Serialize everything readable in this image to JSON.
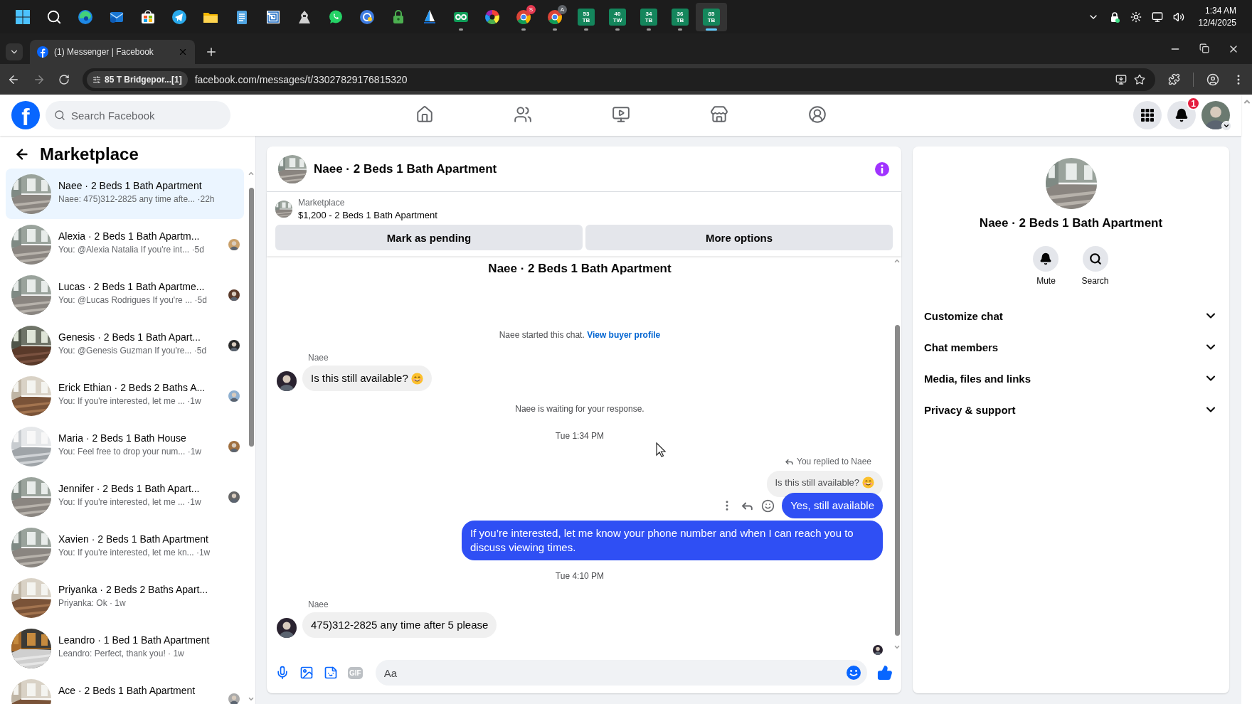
{
  "taskbar": {
    "apps": [
      {
        "kind": "start",
        "running": false,
        "selected": false
      },
      {
        "kind": "search",
        "running": false,
        "selected": false
      },
      {
        "kind": "edge",
        "running": false,
        "selected": false
      },
      {
        "kind": "mail",
        "running": false,
        "selected": false
      },
      {
        "kind": "store",
        "running": false,
        "selected": false
      },
      {
        "kind": "telegram",
        "running": false,
        "selected": false
      },
      {
        "kind": "folder",
        "running": false,
        "selected": false
      },
      {
        "kind": "notepad",
        "running": false,
        "selected": false
      },
      {
        "kind": "maze",
        "running": false,
        "selected": false
      },
      {
        "kind": "figure",
        "running": false,
        "selected": false
      },
      {
        "kind": "whatsapp",
        "running": false,
        "selected": false
      },
      {
        "kind": "orb",
        "running": false,
        "selected": false
      },
      {
        "kind": "lock",
        "running": false,
        "selected": false
      },
      {
        "kind": "sail",
        "running": false,
        "selected": false
      },
      {
        "kind": "tape",
        "running": true,
        "selected": false
      },
      {
        "kind": "wheel",
        "running": false,
        "selected": false
      },
      {
        "kind": "chrome",
        "badge": "S",
        "running": true,
        "selected": false
      },
      {
        "kind": "chrome",
        "badge": "A",
        "running": true,
        "selected": false
      },
      {
        "kind": "tile",
        "label": "53 TB",
        "running": true,
        "selected": false
      },
      {
        "kind": "tile",
        "label": "40 TW",
        "running": true,
        "selected": false
      },
      {
        "kind": "tile",
        "label": "34 TB",
        "running": true,
        "selected": false
      },
      {
        "kind": "tile",
        "label": "36 TB",
        "running": true,
        "selected": false
      },
      {
        "kind": "tile",
        "label": "85 TB",
        "running": true,
        "selected": true
      }
    ],
    "time": "1:34 AM",
    "date": "12/4/2025"
  },
  "browser": {
    "tab": {
      "title": "(1) Messenger | Facebook"
    },
    "site_chip": "85 T Bridgepor...[1]",
    "url": "facebook.com/messages/t/33027829176815320"
  },
  "facebook": {
    "logo": "f",
    "search": {
      "placeholder": "Search Facebook"
    },
    "nav": [
      {
        "kind": "home",
        "selected": false
      },
      {
        "kind": "friends",
        "selected": false
      },
      {
        "kind": "video",
        "selected": false
      },
      {
        "kind": "marketplace",
        "selected": false
      },
      {
        "kind": "groups",
        "selected": false
      }
    ],
    "notifications_badge": "1"
  },
  "sidebar": {
    "title": "Marketplace",
    "conversations": [
      {
        "title": "Naee · 2 Beds 1 Bath Apartment",
        "preview": "Naee: 475)312-2825 any time afte... ·22h",
        "selected": true,
        "seen": false
      },
      {
        "title": "Alexia · 2 Beds 1 Bath Apartm...",
        "preview": "You: @Alexia Natalia If you're int... ·5d",
        "selected": false,
        "seen": true
      },
      {
        "title": "Lucas · 2 Beds 1 Bath Apartme...",
        "preview": "You: @Lucas Rodrigues If you're ... ·5d",
        "selected": false,
        "seen": true
      },
      {
        "title": "Genesis · 2 Beds 1 Bath Apart...",
        "preview": "You: @Genesis Guzman If you're... ·5d",
        "selected": false,
        "seen": true
      },
      {
        "title": "Erick Ethian · 2 Beds 2 Baths A...",
        "preview": "You: If you're interested, let me ... ·1w",
        "selected": false,
        "seen": true
      },
      {
        "title": "Maria · 2 Beds 1 Bath House",
        "preview": "You: Feel free to drop your num... ·1w",
        "selected": false,
        "seen": true
      },
      {
        "title": "Jennifer · 2 Beds 1 Bath Apart...",
        "preview": "You: If you're interested, let me ... ·1w",
        "selected": false,
        "seen": true
      },
      {
        "title": "Xavien · 2 Beds 1 Bath Apartment",
        "preview": "You: If you're interested, let me kn... ·1w",
        "selected": false,
        "seen": false
      },
      {
        "title": "Priyanka · 2 Beds 2 Baths Apart...",
        "preview": "Priyanka: Ok · 1w",
        "selected": false,
        "seen": false
      },
      {
        "title": "Leandro · 1 Bed 1 Bath Apartment",
        "preview": "Leandro: Perfect, thank you! · 1w",
        "selected": false,
        "seen": false
      },
      {
        "title": "Ace · 2 Beds 1 Bath Apartment",
        "selected": false,
        "seen": true
      }
    ]
  },
  "chat": {
    "title": "Naee · 2 Beds 1 Bath Apartment",
    "listing": {
      "label": "Marketplace",
      "title": "$1,200 - 2 Beds 1 Bath Apartment"
    },
    "buttons": [
      "Mark as pending",
      "More options"
    ],
    "messages": [
      {
        "kind": "title",
        "text": "Naee · 2 Beds 1 Bath Apartment"
      },
      {
        "kind": "system",
        "text": "Naee started this chat.",
        "link": "View buyer profile"
      },
      {
        "kind": "incoming",
        "sender": "Naee",
        "text": "Is this still available?",
        "emoji": true
      },
      {
        "kind": "system",
        "text": "Naee is waiting for your response."
      },
      {
        "kind": "time",
        "text": "Tue 1:34 PM"
      },
      {
        "kind": "outgoing",
        "reply_label": "You replied to Naee",
        "quote": "Is this still available?",
        "quote_emoji": true,
        "text": "Yes, still available",
        "actions": true
      },
      {
        "kind": "outgoing",
        "text": "If you’re interested, let me know your phone number and when I can reach you to discuss viewing times.",
        "actions": false
      },
      {
        "kind": "time",
        "text": "Tue 4:10 PM"
      },
      {
        "kind": "incoming",
        "sender": "Naee",
        "text": "475)312-2825 any time after 5 please",
        "emoji": false
      }
    ],
    "read_receipt": true,
    "composer": {
      "gif": "GIF",
      "placeholder": "Aa"
    }
  },
  "details": {
    "title": "Naee · 2 Beds 1 Bath Apartment",
    "actions": [
      {
        "kind": "mute",
        "label": "Mute"
      },
      {
        "kind": "search",
        "label": "Search"
      }
    ],
    "sections": [
      {
        "label": "Customize chat",
        "expanded": false
      },
      {
        "label": "Chat members",
        "expanded": false
      },
      {
        "label": "Media, files and links",
        "expanded": false
      },
      {
        "label": "Privacy & support",
        "expanded": false
      }
    ]
  }
}
